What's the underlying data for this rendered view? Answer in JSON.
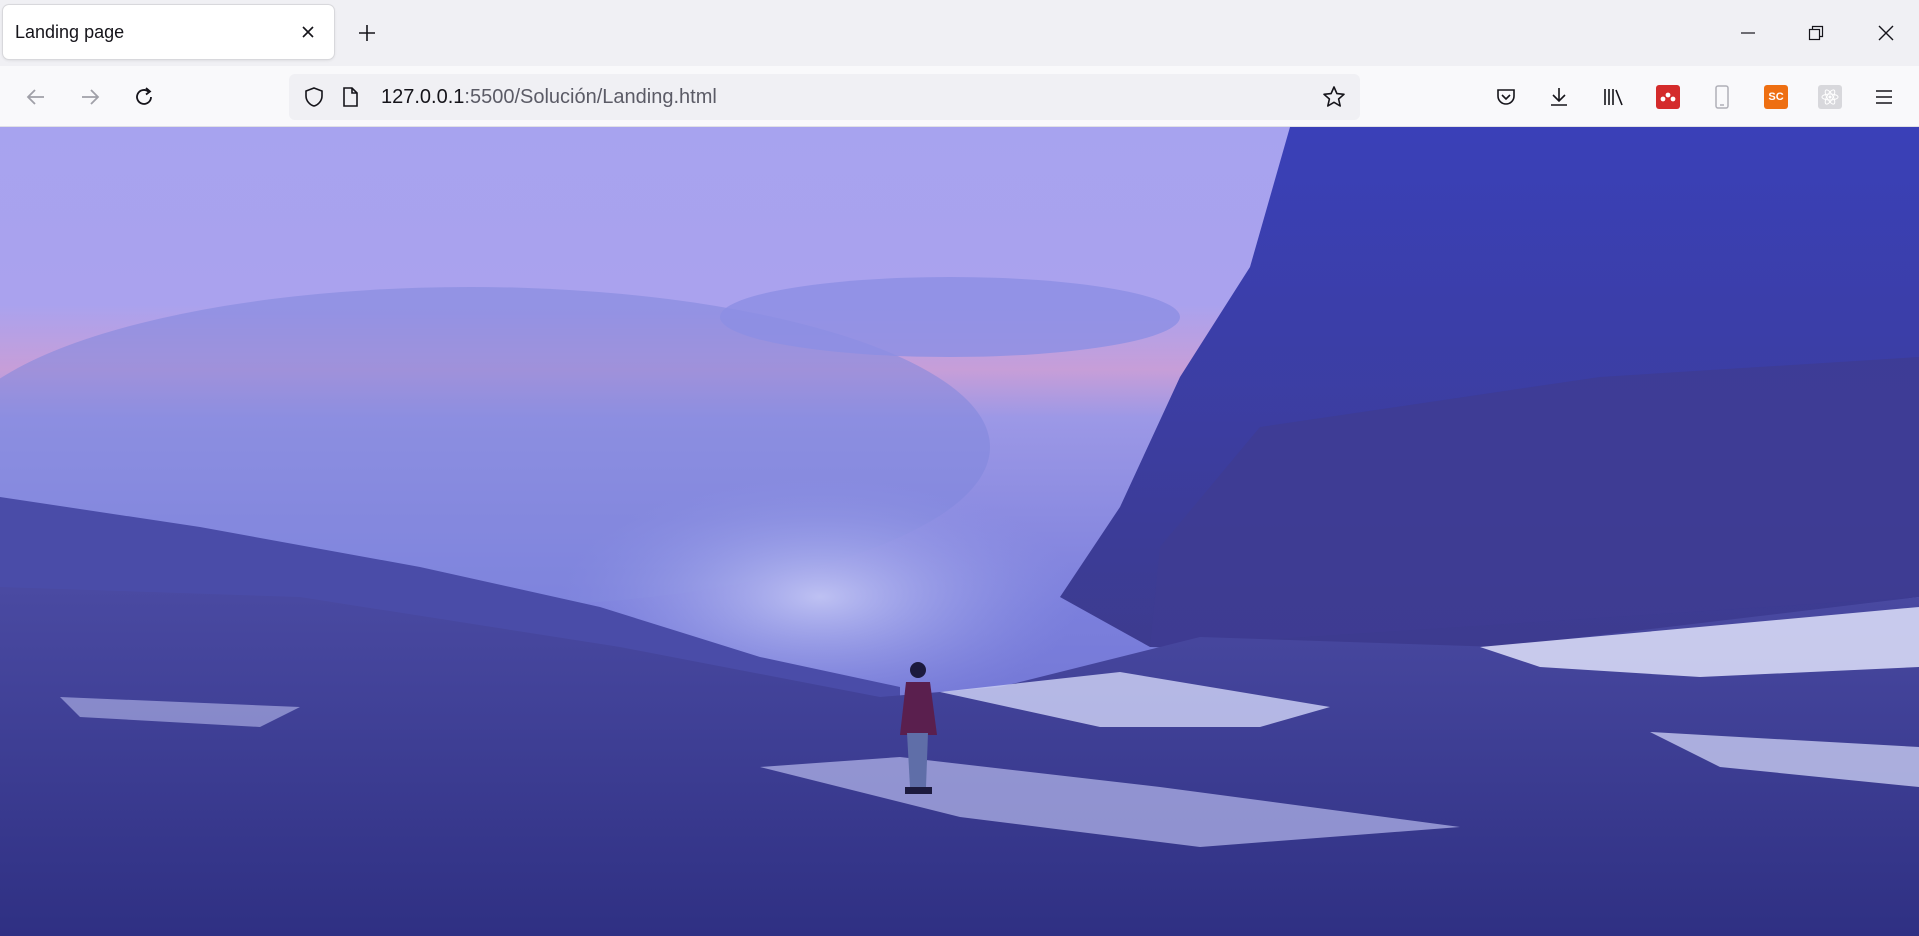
{
  "browser": {
    "tab": {
      "title": "Landing page"
    },
    "url": {
      "host": "127.0.0.1",
      "rest": ":5500/Solución/Landing.html"
    },
    "extensions": [
      {
        "name": "mendeley-extension",
        "color": "#d42b2b"
      },
      {
        "name": "sc-extension",
        "label": "SC",
        "color": "#ee6f12"
      }
    ]
  },
  "page": {
    "hero_image": "mountain-landscape-hiker-blue-dusk"
  }
}
